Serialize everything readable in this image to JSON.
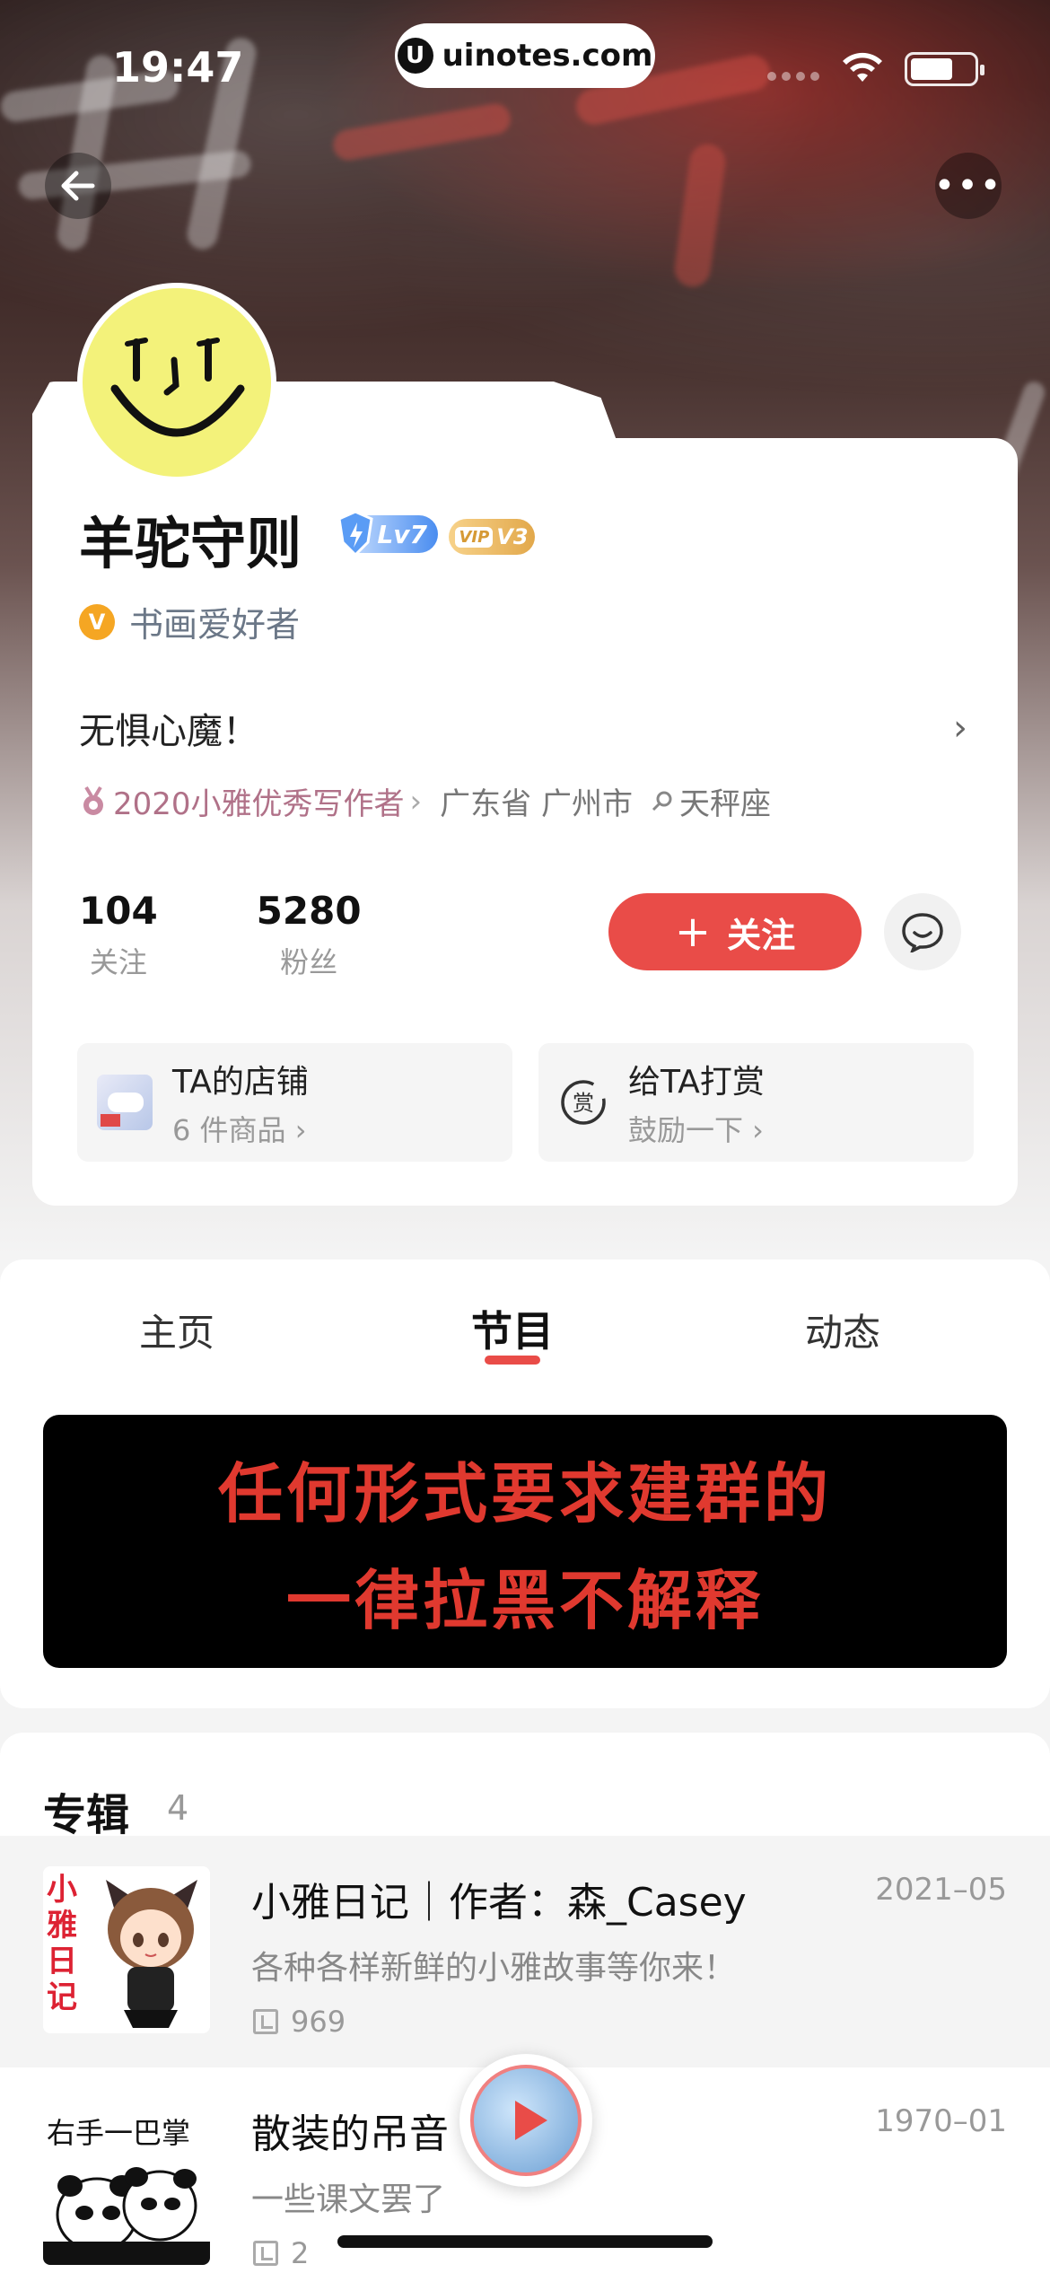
{
  "status_bar": {
    "time": "19:47",
    "url": "uinotes.com",
    "url_logo": "U"
  },
  "header": {
    "back_icon": "arrow-left-icon",
    "more_icon": "more-dots-icon",
    "more_label": "•••"
  },
  "profile": {
    "name": "羊驼守则",
    "level_badge": "Lv7",
    "vip_badge_mark": "VIP",
    "vip_badge_level": "V3",
    "verify_mark": "V",
    "verify_label": "书画爱好者",
    "bio": "无惧心魔！",
    "bio_arrow": "›",
    "award": "2020小雅优秀写作者",
    "award_arrow": "›",
    "location": "广东省 广州市",
    "zodiac": "天秤座",
    "stats": [
      {
        "num": "104",
        "label": "关注"
      },
      {
        "num": "5280",
        "label": "粉丝"
      }
    ],
    "follow_plus": "+",
    "follow_label": "关注",
    "shop": {
      "title": "TA的店铺",
      "sub": "6 件商品 ›"
    },
    "reward": {
      "title": "给TA打赏",
      "sub": "鼓励一下 ›",
      "icon_text": "赏"
    }
  },
  "tabs": [
    {
      "label": "主页"
    },
    {
      "label": "节目"
    },
    {
      "label": "动态"
    }
  ],
  "active_tab": "节目",
  "banner": {
    "line1": "任何形式要求建群的",
    "line2": "一律拉黑不解释",
    "text_color": "#e0392f"
  },
  "albums": {
    "title": "专辑",
    "count": "4",
    "items": [
      {
        "title": "小雅日记｜作者：森_Casey",
        "desc": "各种各样新鲜的小雅故事等你来！",
        "count": "969",
        "date": "2021–05",
        "cover_text": "小雅日记"
      },
      {
        "title": "散装的吊音",
        "desc": "一些课文罢了",
        "count": "2",
        "date": "1970–01",
        "cover_text": "右手一巴掌"
      }
    ]
  },
  "colors": {
    "accent": "#e94c48",
    "avatar_bg": "#f3f27a",
    "award": "#b07188"
  }
}
